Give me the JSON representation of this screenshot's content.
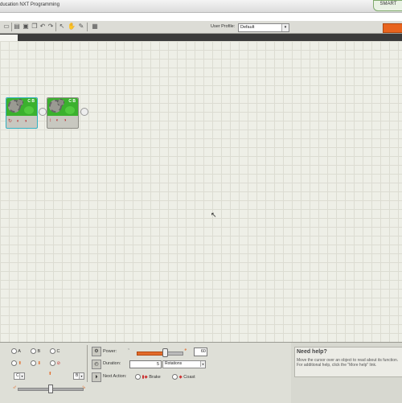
{
  "window": {
    "title": "ducation NXT Programming"
  },
  "smart_button": {
    "label": "SMART"
  },
  "toolbar": {
    "user_profile_label": "User Profile:",
    "user_profile_value": "Default"
  },
  "blocks": [
    {
      "ports": "C B",
      "selected": true,
      "bottom_icons": "↻ ◐ ◑"
    },
    {
      "ports": "C B",
      "selected": false,
      "bottom_icons": "↕ ◐ ◑"
    }
  ],
  "config": {
    "port_a": "A",
    "port_b": "B",
    "port_c": "C",
    "steer_left_select": "C",
    "steer_right_select": "B",
    "power_label": "Power:",
    "power_value": "60",
    "power_fraction": 0.6,
    "duration_label": "Duration:",
    "duration_value": "5",
    "duration_unit": "Rotations",
    "next_action_label": "Next Action:",
    "brake_label": "Brake",
    "coast_label": "Coast",
    "steer_fraction": 0.5
  },
  "help": {
    "title": "Need help?",
    "text": "Move the cursor over an object to read about its function. For additional help, click the \"More help\" link."
  },
  "colors": {
    "accent_orange": "#e8641e",
    "block_green": "#3bb12e"
  }
}
